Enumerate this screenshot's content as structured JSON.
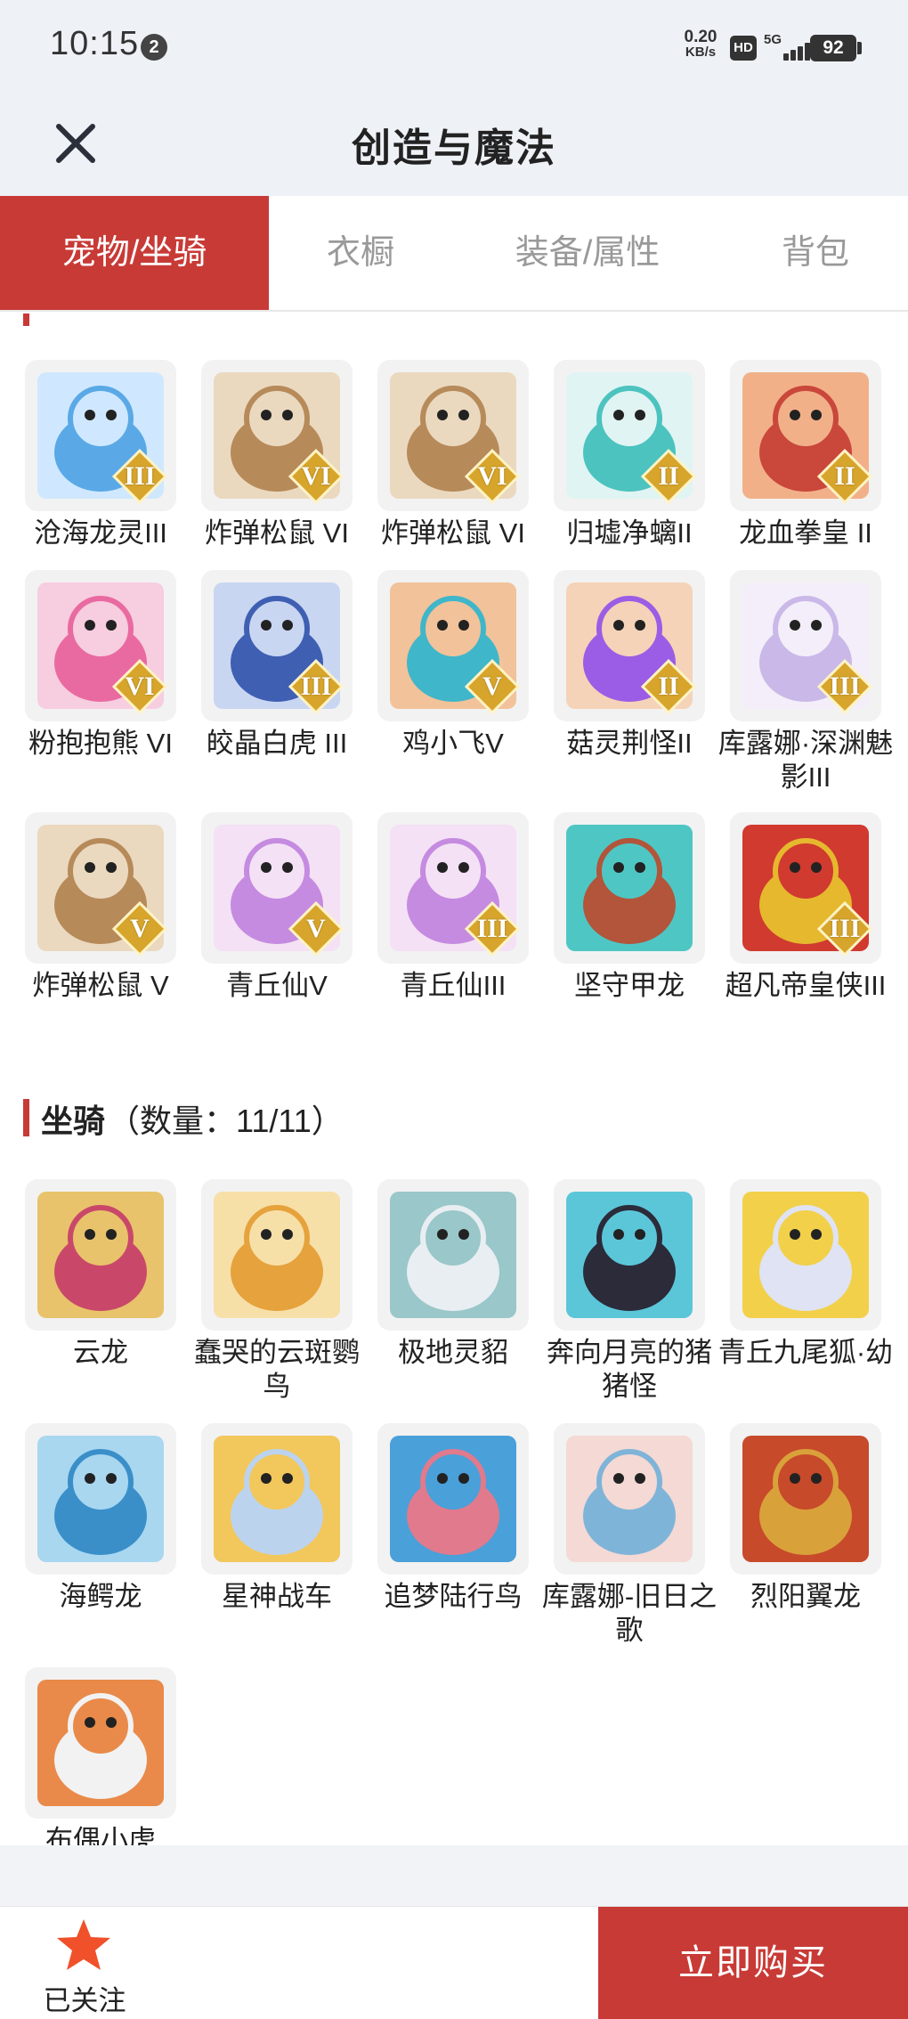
{
  "status_bar": {
    "time": "10:15",
    "notification_count": "2",
    "net_speed_value": "0.20",
    "net_speed_unit": "KB/s",
    "hd_label": "HD",
    "signal_label": "5G",
    "battery": "92"
  },
  "header": {
    "title": "创造与魔法",
    "close_icon": "close-icon"
  },
  "tabs": [
    {
      "label": "宠物/坐骑",
      "active": true
    },
    {
      "label": "衣橱",
      "active": false
    },
    {
      "label": "装备/属性",
      "active": false
    },
    {
      "label": "背包",
      "active": false
    }
  ],
  "pets": [
    {
      "name": "沧海龙灵III",
      "tier": "III",
      "palette": [
        "#5aa9e6",
        "#cfe8ff"
      ]
    },
    {
      "name": "炸弹松鼠 VI",
      "tier": "VI",
      "palette": [
        "#b78a5a",
        "#ead9bf"
      ]
    },
    {
      "name": "炸弹松鼠 VI",
      "tier": "VI",
      "palette": [
        "#b78a5a",
        "#ead9bf"
      ]
    },
    {
      "name": "归墟净螭II",
      "tier": "II",
      "palette": [
        "#4cc3bf",
        "#e0f4f3"
      ]
    },
    {
      "name": "龙血拳皇 II",
      "tier": "II",
      "palette": [
        "#c9473b",
        "#f2b089"
      ]
    },
    {
      "name": "粉抱抱熊 VI",
      "tier": "VI",
      "palette": [
        "#e96aa0",
        "#f7cde0"
      ]
    },
    {
      "name": "皎晶白虎 III",
      "tier": "III",
      "palette": [
        "#3f5fb3",
        "#c9d6f2"
      ]
    },
    {
      "name": "鸡小飞V",
      "tier": "V",
      "palette": [
        "#3fb6c9",
        "#f2c29a"
      ]
    },
    {
      "name": "菇灵荆怪II",
      "tier": "II",
      "palette": [
        "#9b5de5",
        "#f5d3b8"
      ]
    },
    {
      "name": "库露娜·深渊魅影III",
      "tier": "III",
      "palette": [
        "#c9b8e8",
        "#f3eef9"
      ]
    },
    {
      "name": "炸弹松鼠 V",
      "tier": "V",
      "palette": [
        "#b78a5a",
        "#ead9bf"
      ]
    },
    {
      "name": "青丘仙V",
      "tier": "V",
      "palette": [
        "#c58be0",
        "#f4e1f5"
      ]
    },
    {
      "name": "青丘仙III",
      "tier": "III",
      "palette": [
        "#c58be0",
        "#f4e1f5"
      ]
    },
    {
      "name": "坚守甲龙",
      "tier": "",
      "palette": [
        "#b2553a",
        "#4ec7c4"
      ]
    },
    {
      "name": "超凡帝皇侠III",
      "tier": "III",
      "palette": [
        "#e6b82e",
        "#d03a2f"
      ]
    }
  ],
  "mounts_section": {
    "title": "坐骑",
    "count": "（数量：11/11）"
  },
  "mounts": [
    {
      "name": "云龙",
      "palette": [
        "#c9486a",
        "#e8c36b"
      ]
    },
    {
      "name": "蠢哭的云斑鹦鸟",
      "palette": [
        "#e6a23c",
        "#f7dfa8"
      ]
    },
    {
      "name": "极地灵貂",
      "palette": [
        "#e9eef2",
        "#9ac7c9"
      ]
    },
    {
      "name": "奔向月亮的猪猪怪",
      "palette": [
        "#2b2b3a",
        "#5cc6d9"
      ]
    },
    {
      "name": "青丘九尾狐·幼",
      "palette": [
        "#dfe3f3",
        "#f2d04a"
      ]
    },
    {
      "name": "海鳄龙",
      "palette": [
        "#3a8fc9",
        "#a9d7f0"
      ]
    },
    {
      "name": "星神战车",
      "palette": [
        "#bcd3ee",
        "#f2c75c"
      ]
    },
    {
      "name": "追梦陆行鸟",
      "palette": [
        "#e07a8c",
        "#4aa0d9"
      ]
    },
    {
      "name": "库露娜-旧日之歌",
      "palette": [
        "#7fb4d9",
        "#f4d9d4"
      ]
    },
    {
      "name": "烈阳翼龙",
      "palette": [
        "#d9a13a",
        "#c74a2a"
      ]
    },
    {
      "name": "布偶小虎",
      "palette": [
        "#f2f2f2",
        "#e98a4a"
      ]
    }
  ],
  "bottom_bar": {
    "follow_label": "已关注",
    "follow_icon": "star-icon",
    "buy_label": "立即购买"
  },
  "colors": {
    "accent": "#c83a36",
    "header_bg": "#eef2f7",
    "star": "#f0502a",
    "tier_badge": "#d7a52b"
  }
}
